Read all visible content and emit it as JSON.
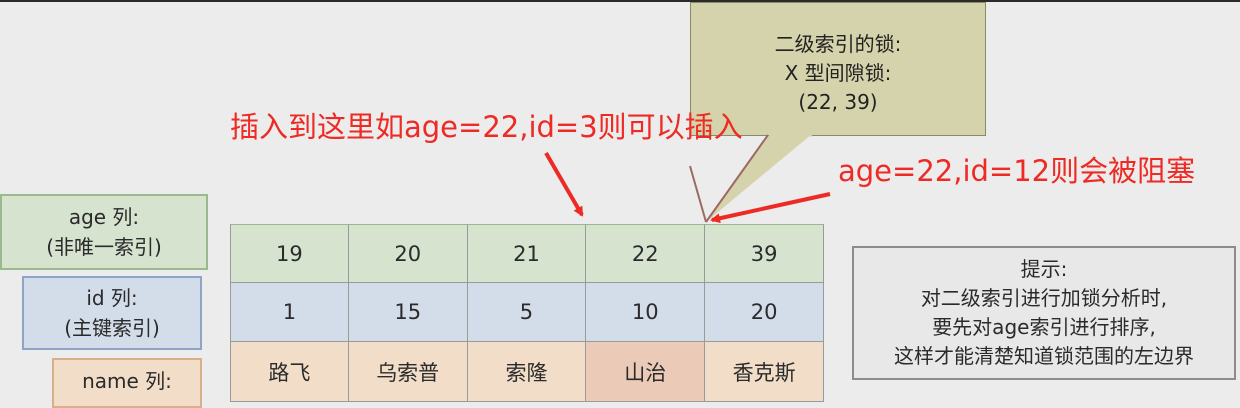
{
  "labels": {
    "age": {
      "title": "age 列:",
      "subtitle": "(非唯一索引)"
    },
    "id": {
      "title": "id 列:",
      "subtitle": "(主键索引)"
    },
    "name": {
      "title": "name 列:"
    }
  },
  "table": {
    "age": [
      "19",
      "20",
      "21",
      "22",
      "39"
    ],
    "id": [
      "1",
      "15",
      "5",
      "10",
      "20"
    ],
    "name": [
      "路飞",
      "乌索普",
      "索隆",
      "山治",
      "香克斯"
    ]
  },
  "annotations": {
    "insert_ok": "插入到这里如age=22,id=3则可以插入",
    "blocked": "age=22,id=12则会被阻塞"
  },
  "callout": {
    "line1": "二级索引的锁:",
    "line2": "X 型间隙锁:",
    "line3": "(22, 39)"
  },
  "hint": {
    "title": "提示:",
    "line1": "对二级索引进行加锁分析时,",
    "line2": "要先对age索引进行排序,",
    "line3": "这样才能清楚知道锁范围的左边界"
  },
  "colors": {
    "age_fill": "#d6e3cf",
    "id_fill": "#d3dce9",
    "name_fill": "#f2dec8",
    "annotation_red": "#ee2a24",
    "callout_fill": "#d5d3ab"
  }
}
